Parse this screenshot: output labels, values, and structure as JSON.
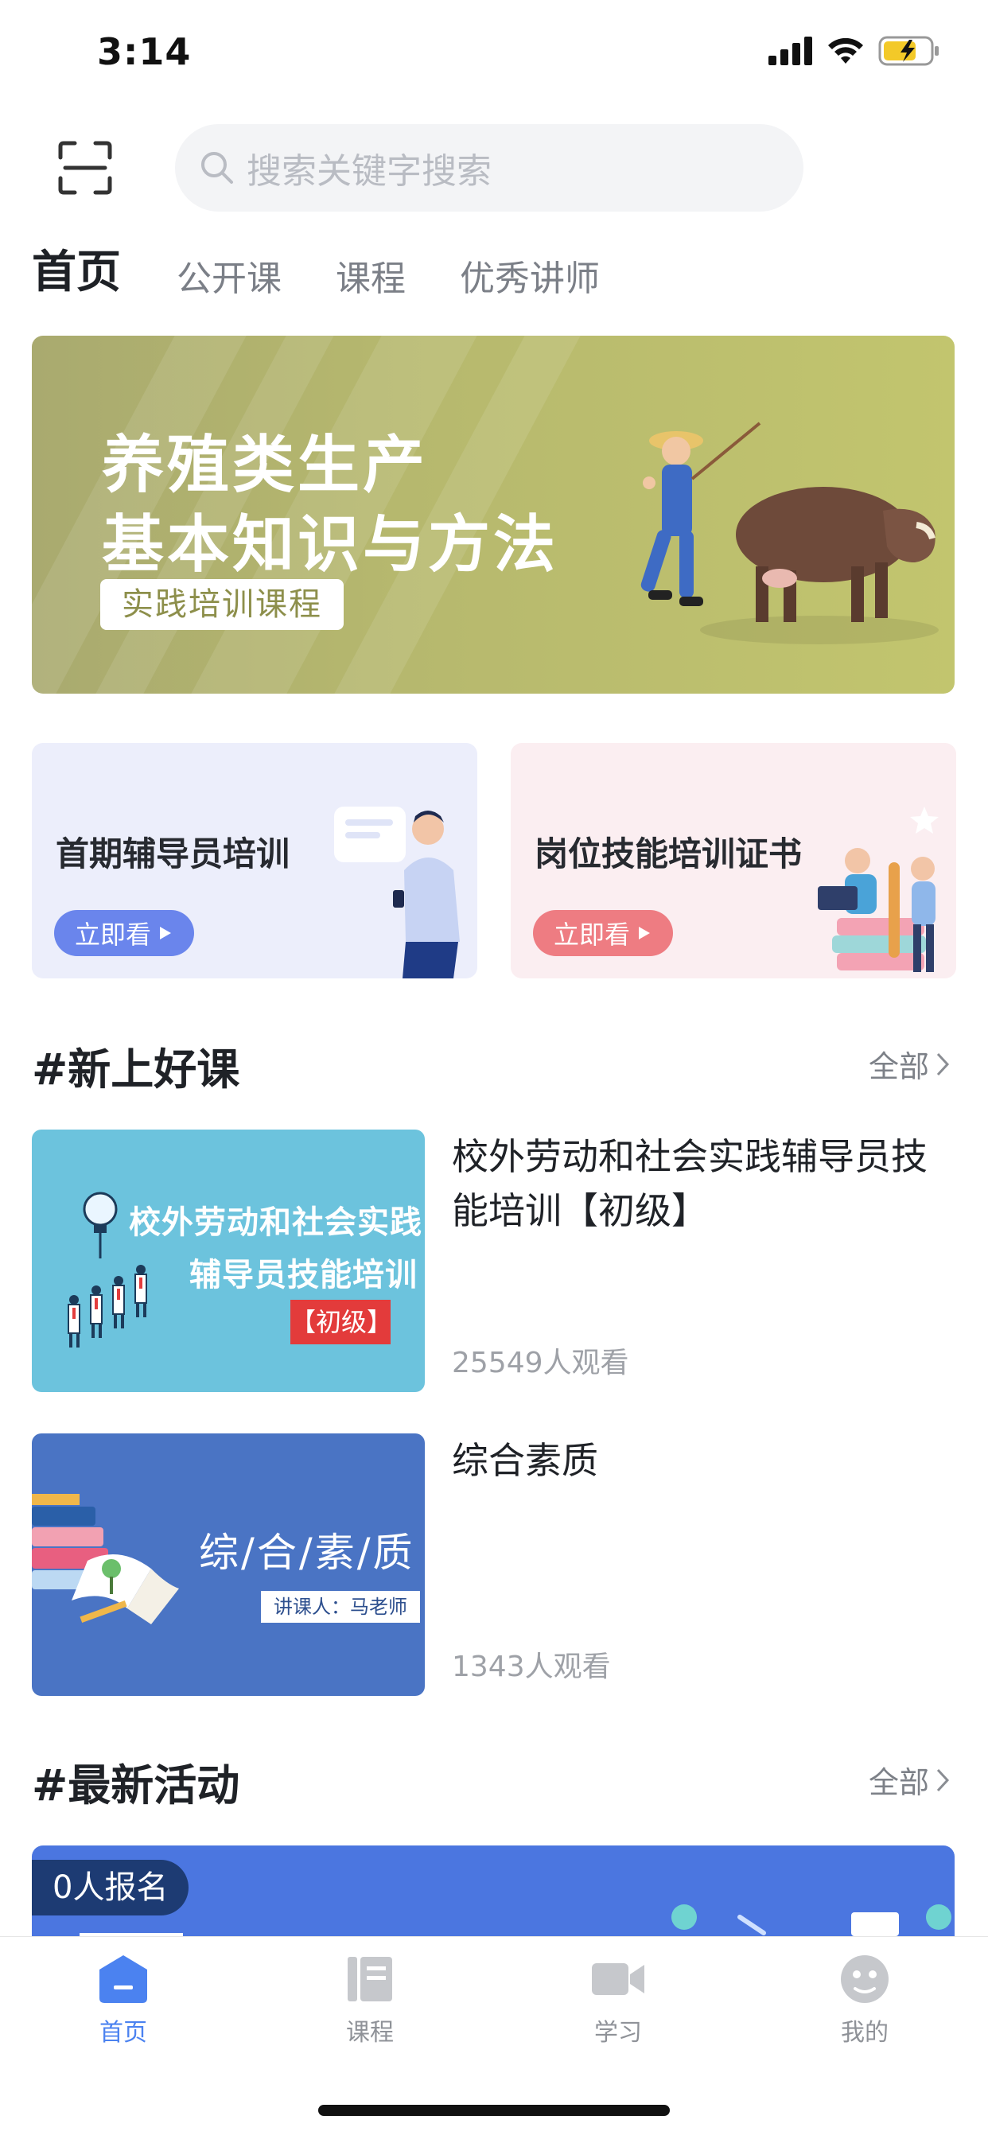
{
  "status_bar": {
    "time": "3:14"
  },
  "header": {
    "search_placeholder": "搜索关键字搜索"
  },
  "tabs": [
    {
      "label": "首页",
      "active": true
    },
    {
      "label": "公开课"
    },
    {
      "label": "课程"
    },
    {
      "label": "优秀讲师"
    }
  ],
  "banner": {
    "line1": "养殖类生产",
    "line2": "基本知识与方法",
    "tag": "实践培训课程"
  },
  "cards": [
    {
      "title": "首期辅导员培训",
      "button": "立即看",
      "color": "#6a85ec"
    },
    {
      "title": "岗位技能培训证书",
      "button": "立即看",
      "color": "#ee7c82"
    }
  ],
  "sections": {
    "new_courses": {
      "title": "#新上好课",
      "more": "全部"
    },
    "latest_activities": {
      "title": "#最新活动",
      "more": "全部"
    }
  },
  "courses": [
    {
      "title": "校外劳动和社会实践辅导员技能培训【初级】",
      "views": "25549人观看",
      "thumb_text_1": "校外劳动和社会实践",
      "thumb_text_2": "辅导员技能培训",
      "thumb_badge": "【初级】"
    },
    {
      "title": "综合素质",
      "views": "1343人观看",
      "thumb_text_1": "综/合/素/质",
      "thumb_badge": "讲课人：马老师"
    }
  ],
  "activity": {
    "enroll_badge": "0人报名"
  },
  "bottom_nav": [
    {
      "label": "首页",
      "icon": "home-icon",
      "active": true
    },
    {
      "label": "课程",
      "icon": "book-icon"
    },
    {
      "label": "学习",
      "icon": "video-camera-icon"
    },
    {
      "label": "我的",
      "icon": "profile-icon"
    }
  ],
  "colors": {
    "accent": "#4b82f0",
    "banner": "#b6b86e",
    "activity": "#4b76e0"
  }
}
